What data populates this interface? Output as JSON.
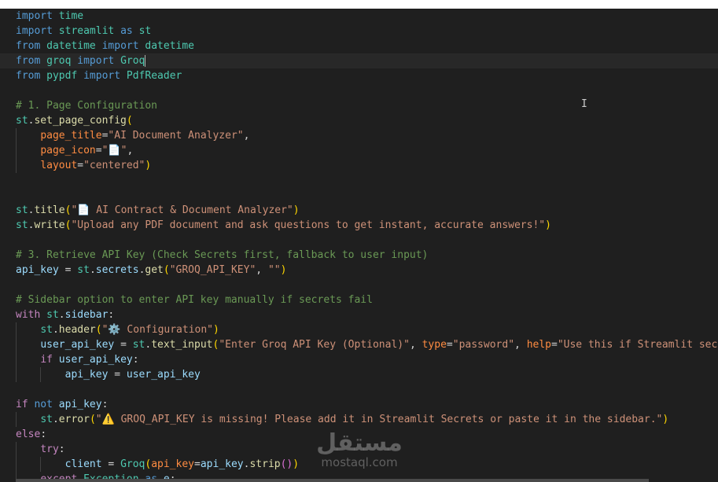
{
  "editor": {
    "lines": [
      {
        "guides": 0,
        "tokens": [
          [
            "kw",
            "import"
          ],
          [
            "pl",
            " "
          ],
          [
            "cls",
            "time"
          ]
        ]
      },
      {
        "guides": 0,
        "tokens": [
          [
            "kw",
            "import"
          ],
          [
            "pl",
            " "
          ],
          [
            "cls",
            "streamlit"
          ],
          [
            "pl",
            " "
          ],
          [
            "kw",
            "as"
          ],
          [
            "pl",
            " "
          ],
          [
            "cls",
            "st"
          ]
        ]
      },
      {
        "guides": 0,
        "tokens": [
          [
            "kw",
            "from"
          ],
          [
            "pl",
            " "
          ],
          [
            "cls",
            "datetime"
          ],
          [
            "pl",
            " "
          ],
          [
            "kw",
            "import"
          ],
          [
            "pl",
            " "
          ],
          [
            "cls",
            "datetime"
          ]
        ]
      },
      {
        "guides": 0,
        "current": true,
        "tokens": [
          [
            "kw",
            "from"
          ],
          [
            "pl",
            " "
          ],
          [
            "cls",
            "groq"
          ],
          [
            "pl",
            " "
          ],
          [
            "kw",
            "import"
          ],
          [
            "pl",
            " "
          ],
          [
            "cls",
            "Groq"
          ],
          [
            "cursor",
            ""
          ]
        ]
      },
      {
        "guides": 0,
        "tokens": [
          [
            "kw",
            "from"
          ],
          [
            "pl",
            " "
          ],
          [
            "cls",
            "pypdf"
          ],
          [
            "pl",
            " "
          ],
          [
            "kw",
            "import"
          ],
          [
            "pl",
            " "
          ],
          [
            "cls",
            "PdfReader"
          ]
        ]
      },
      {
        "guides": 0,
        "tokens": []
      },
      {
        "guides": 0,
        "tokens": [
          [
            "cm",
            "# 1. Page Configuration"
          ]
        ]
      },
      {
        "guides": 0,
        "tokens": [
          [
            "cls",
            "st"
          ],
          [
            "pl",
            "."
          ],
          [
            "fn",
            "set_page_config"
          ],
          [
            "par",
            "("
          ]
        ]
      },
      {
        "guides": 1,
        "tokens": [
          [
            "pl",
            "    "
          ],
          [
            "param",
            "page_title"
          ],
          [
            "op",
            "="
          ],
          [
            "str",
            "\"AI Document Analyzer\""
          ],
          [
            "pl",
            ","
          ]
        ]
      },
      {
        "guides": 1,
        "tokens": [
          [
            "pl",
            "    "
          ],
          [
            "param",
            "page_icon"
          ],
          [
            "op",
            "="
          ],
          [
            "str",
            "\"📄\""
          ],
          [
            "pl",
            ","
          ]
        ]
      },
      {
        "guides": 1,
        "tokens": [
          [
            "pl",
            "    "
          ],
          [
            "param",
            "layout"
          ],
          [
            "op",
            "="
          ],
          [
            "str",
            "\"centered\""
          ],
          [
            "par",
            ")"
          ]
        ]
      },
      {
        "guides": 0,
        "tokens": []
      },
      {
        "guides": 0,
        "tokens": []
      },
      {
        "guides": 0,
        "tokens": [
          [
            "cls",
            "st"
          ],
          [
            "pl",
            "."
          ],
          [
            "fn",
            "title"
          ],
          [
            "par",
            "("
          ],
          [
            "str",
            "\"📄 AI Contract & Document Analyzer\""
          ],
          [
            "par",
            ")"
          ]
        ]
      },
      {
        "guides": 0,
        "tokens": [
          [
            "cls",
            "st"
          ],
          [
            "pl",
            "."
          ],
          [
            "fn",
            "write"
          ],
          [
            "par",
            "("
          ],
          [
            "str",
            "\"Upload any PDF document and ask questions to get instant, accurate answers!\""
          ],
          [
            "par",
            ")"
          ]
        ]
      },
      {
        "guides": 0,
        "tokens": []
      },
      {
        "guides": 0,
        "tokens": [
          [
            "cm",
            "# 3. Retrieve API Key (Check Secrets first, fallback to user input)"
          ]
        ]
      },
      {
        "guides": 0,
        "tokens": [
          [
            "var",
            "api_key"
          ],
          [
            "pl",
            " "
          ],
          [
            "op",
            "="
          ],
          [
            "pl",
            " "
          ],
          [
            "cls",
            "st"
          ],
          [
            "pl",
            "."
          ],
          [
            "var",
            "secrets"
          ],
          [
            "pl",
            "."
          ],
          [
            "fn",
            "get"
          ],
          [
            "par",
            "("
          ],
          [
            "str",
            "\"GROQ_API_KEY\""
          ],
          [
            "pl",
            ", "
          ],
          [
            "str",
            "\"\""
          ],
          [
            "par",
            ")"
          ]
        ]
      },
      {
        "guides": 0,
        "tokens": []
      },
      {
        "guides": 0,
        "tokens": [
          [
            "cm",
            "# Sidebar option to enter API key manually if secrets fail"
          ]
        ]
      },
      {
        "guides": 0,
        "tokens": [
          [
            "ctl",
            "with"
          ],
          [
            "pl",
            " "
          ],
          [
            "cls",
            "st"
          ],
          [
            "pl",
            "."
          ],
          [
            "var",
            "sidebar"
          ],
          [
            "pl",
            ":"
          ]
        ]
      },
      {
        "guides": 1,
        "tokens": [
          [
            "pl",
            "    "
          ],
          [
            "cls",
            "st"
          ],
          [
            "pl",
            "."
          ],
          [
            "fn",
            "header"
          ],
          [
            "par",
            "("
          ],
          [
            "str",
            "\"⚙️ Configuration\""
          ],
          [
            "par",
            ")"
          ]
        ]
      },
      {
        "guides": 1,
        "tokens": [
          [
            "pl",
            "    "
          ],
          [
            "var",
            "user_api_key"
          ],
          [
            "pl",
            " "
          ],
          [
            "op",
            "="
          ],
          [
            "pl",
            " "
          ],
          [
            "cls",
            "st"
          ],
          [
            "pl",
            "."
          ],
          [
            "fn",
            "text_input"
          ],
          [
            "par",
            "("
          ],
          [
            "str",
            "\"Enter Groq API Key (Optional)\""
          ],
          [
            "pl",
            ", "
          ],
          [
            "param",
            "type"
          ],
          [
            "op",
            "="
          ],
          [
            "str",
            "\"password\""
          ],
          [
            "pl",
            ", "
          ],
          [
            "param",
            "help"
          ],
          [
            "op",
            "="
          ],
          [
            "str",
            "\"Use this if Streamlit secre"
          ]
        ]
      },
      {
        "guides": 1,
        "tokens": [
          [
            "pl",
            "    "
          ],
          [
            "ctl",
            "if"
          ],
          [
            "pl",
            " "
          ],
          [
            "var",
            "user_api_key"
          ],
          [
            "pl",
            ":"
          ]
        ]
      },
      {
        "guides": 2,
        "tokens": [
          [
            "pl",
            "        "
          ],
          [
            "var",
            "api_key"
          ],
          [
            "pl",
            " "
          ],
          [
            "op",
            "="
          ],
          [
            "pl",
            " "
          ],
          [
            "var",
            "user_api_key"
          ]
        ]
      },
      {
        "guides": 0,
        "tokens": []
      },
      {
        "guides": 0,
        "tokens": [
          [
            "ctl",
            "if"
          ],
          [
            "pl",
            " "
          ],
          [
            "kw",
            "not"
          ],
          [
            "pl",
            " "
          ],
          [
            "var",
            "api_key"
          ],
          [
            "pl",
            ":"
          ]
        ]
      },
      {
        "guides": 1,
        "tokens": [
          [
            "pl",
            "    "
          ],
          [
            "cls",
            "st"
          ],
          [
            "pl",
            "."
          ],
          [
            "fn",
            "error"
          ],
          [
            "par",
            "("
          ],
          [
            "str",
            "\"⚠️ GROQ_API_KEY is missing! Please add it in Streamlit Secrets or paste it in the sidebar.\""
          ],
          [
            "par",
            ")"
          ]
        ]
      },
      {
        "guides": 0,
        "tokens": [
          [
            "ctl",
            "else"
          ],
          [
            "pl",
            ":"
          ]
        ]
      },
      {
        "guides": 1,
        "tokens": [
          [
            "pl",
            "    "
          ],
          [
            "ctl",
            "try"
          ],
          [
            "pl",
            ":"
          ]
        ]
      },
      {
        "guides": 2,
        "tokens": [
          [
            "pl",
            "        "
          ],
          [
            "var",
            "client"
          ],
          [
            "pl",
            " "
          ],
          [
            "op",
            "="
          ],
          [
            "pl",
            " "
          ],
          [
            "cls",
            "Groq"
          ],
          [
            "par",
            "("
          ],
          [
            "param",
            "api_key"
          ],
          [
            "op",
            "="
          ],
          [
            "var",
            "api_key"
          ],
          [
            "pl",
            "."
          ],
          [
            "fn",
            "strip"
          ],
          [
            "par2",
            "()"
          ],
          [
            "par",
            ")"
          ]
        ]
      },
      {
        "guides": 1,
        "tokens": [
          [
            "pl",
            "    "
          ],
          [
            "ctl",
            "except"
          ],
          [
            "pl",
            " "
          ],
          [
            "cls",
            "Exception"
          ],
          [
            "pl",
            " "
          ],
          [
            "kw",
            "as"
          ],
          [
            "pl",
            " "
          ],
          [
            "var",
            "e"
          ],
          [
            "pl",
            ":"
          ]
        ]
      }
    ]
  },
  "watermark": {
    "arabic": "مستقل",
    "latin": "mostaql.com"
  }
}
